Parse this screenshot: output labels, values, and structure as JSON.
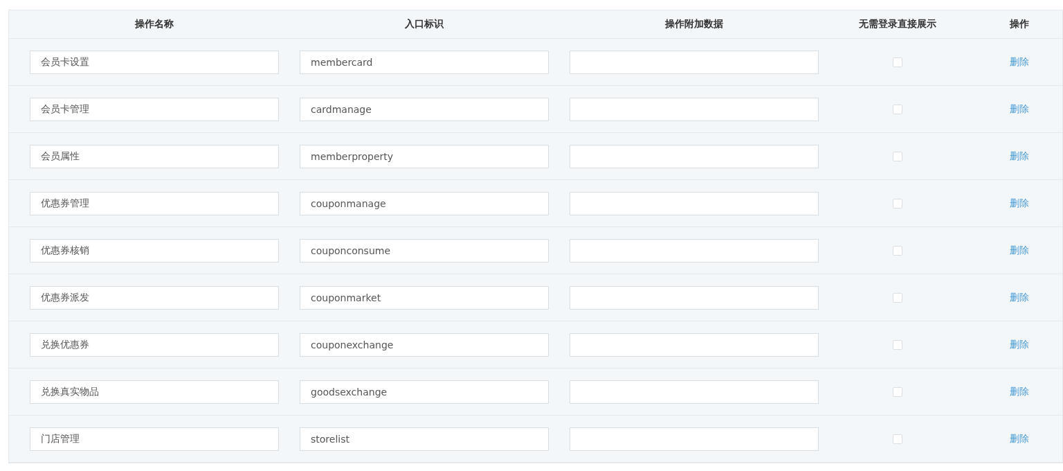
{
  "table": {
    "columns": [
      "操作名称",
      "入口标识",
      "操作附加数据",
      "无需登录直接展示",
      "操作"
    ],
    "rows": [
      {
        "name": "会员卡设置",
        "entry": "membercard",
        "extra": "",
        "no_login": false,
        "action": "删除"
      },
      {
        "name": "会员卡管理",
        "entry": "cardmanage",
        "extra": "",
        "no_login": false,
        "action": "删除"
      },
      {
        "name": "会员属性",
        "entry": "memberproperty",
        "extra": "",
        "no_login": false,
        "action": "删除"
      },
      {
        "name": "优惠券管理",
        "entry": "couponmanage",
        "extra": "",
        "no_login": false,
        "action": "删除"
      },
      {
        "name": "优惠券核销",
        "entry": "couponconsume",
        "extra": "",
        "no_login": false,
        "action": "删除"
      },
      {
        "name": "优惠券派发",
        "entry": "couponmarket",
        "extra": "",
        "no_login": false,
        "action": "删除"
      },
      {
        "name": "兑换优惠券",
        "entry": "couponexchange",
        "extra": "",
        "no_login": false,
        "action": "删除"
      },
      {
        "name": "兑换真实物品",
        "entry": "goodsexchange",
        "extra": "",
        "no_login": false,
        "action": "删除"
      },
      {
        "name": "门店管理",
        "entry": "storelist",
        "extra": "",
        "no_login": false,
        "action": "删除"
      }
    ]
  }
}
